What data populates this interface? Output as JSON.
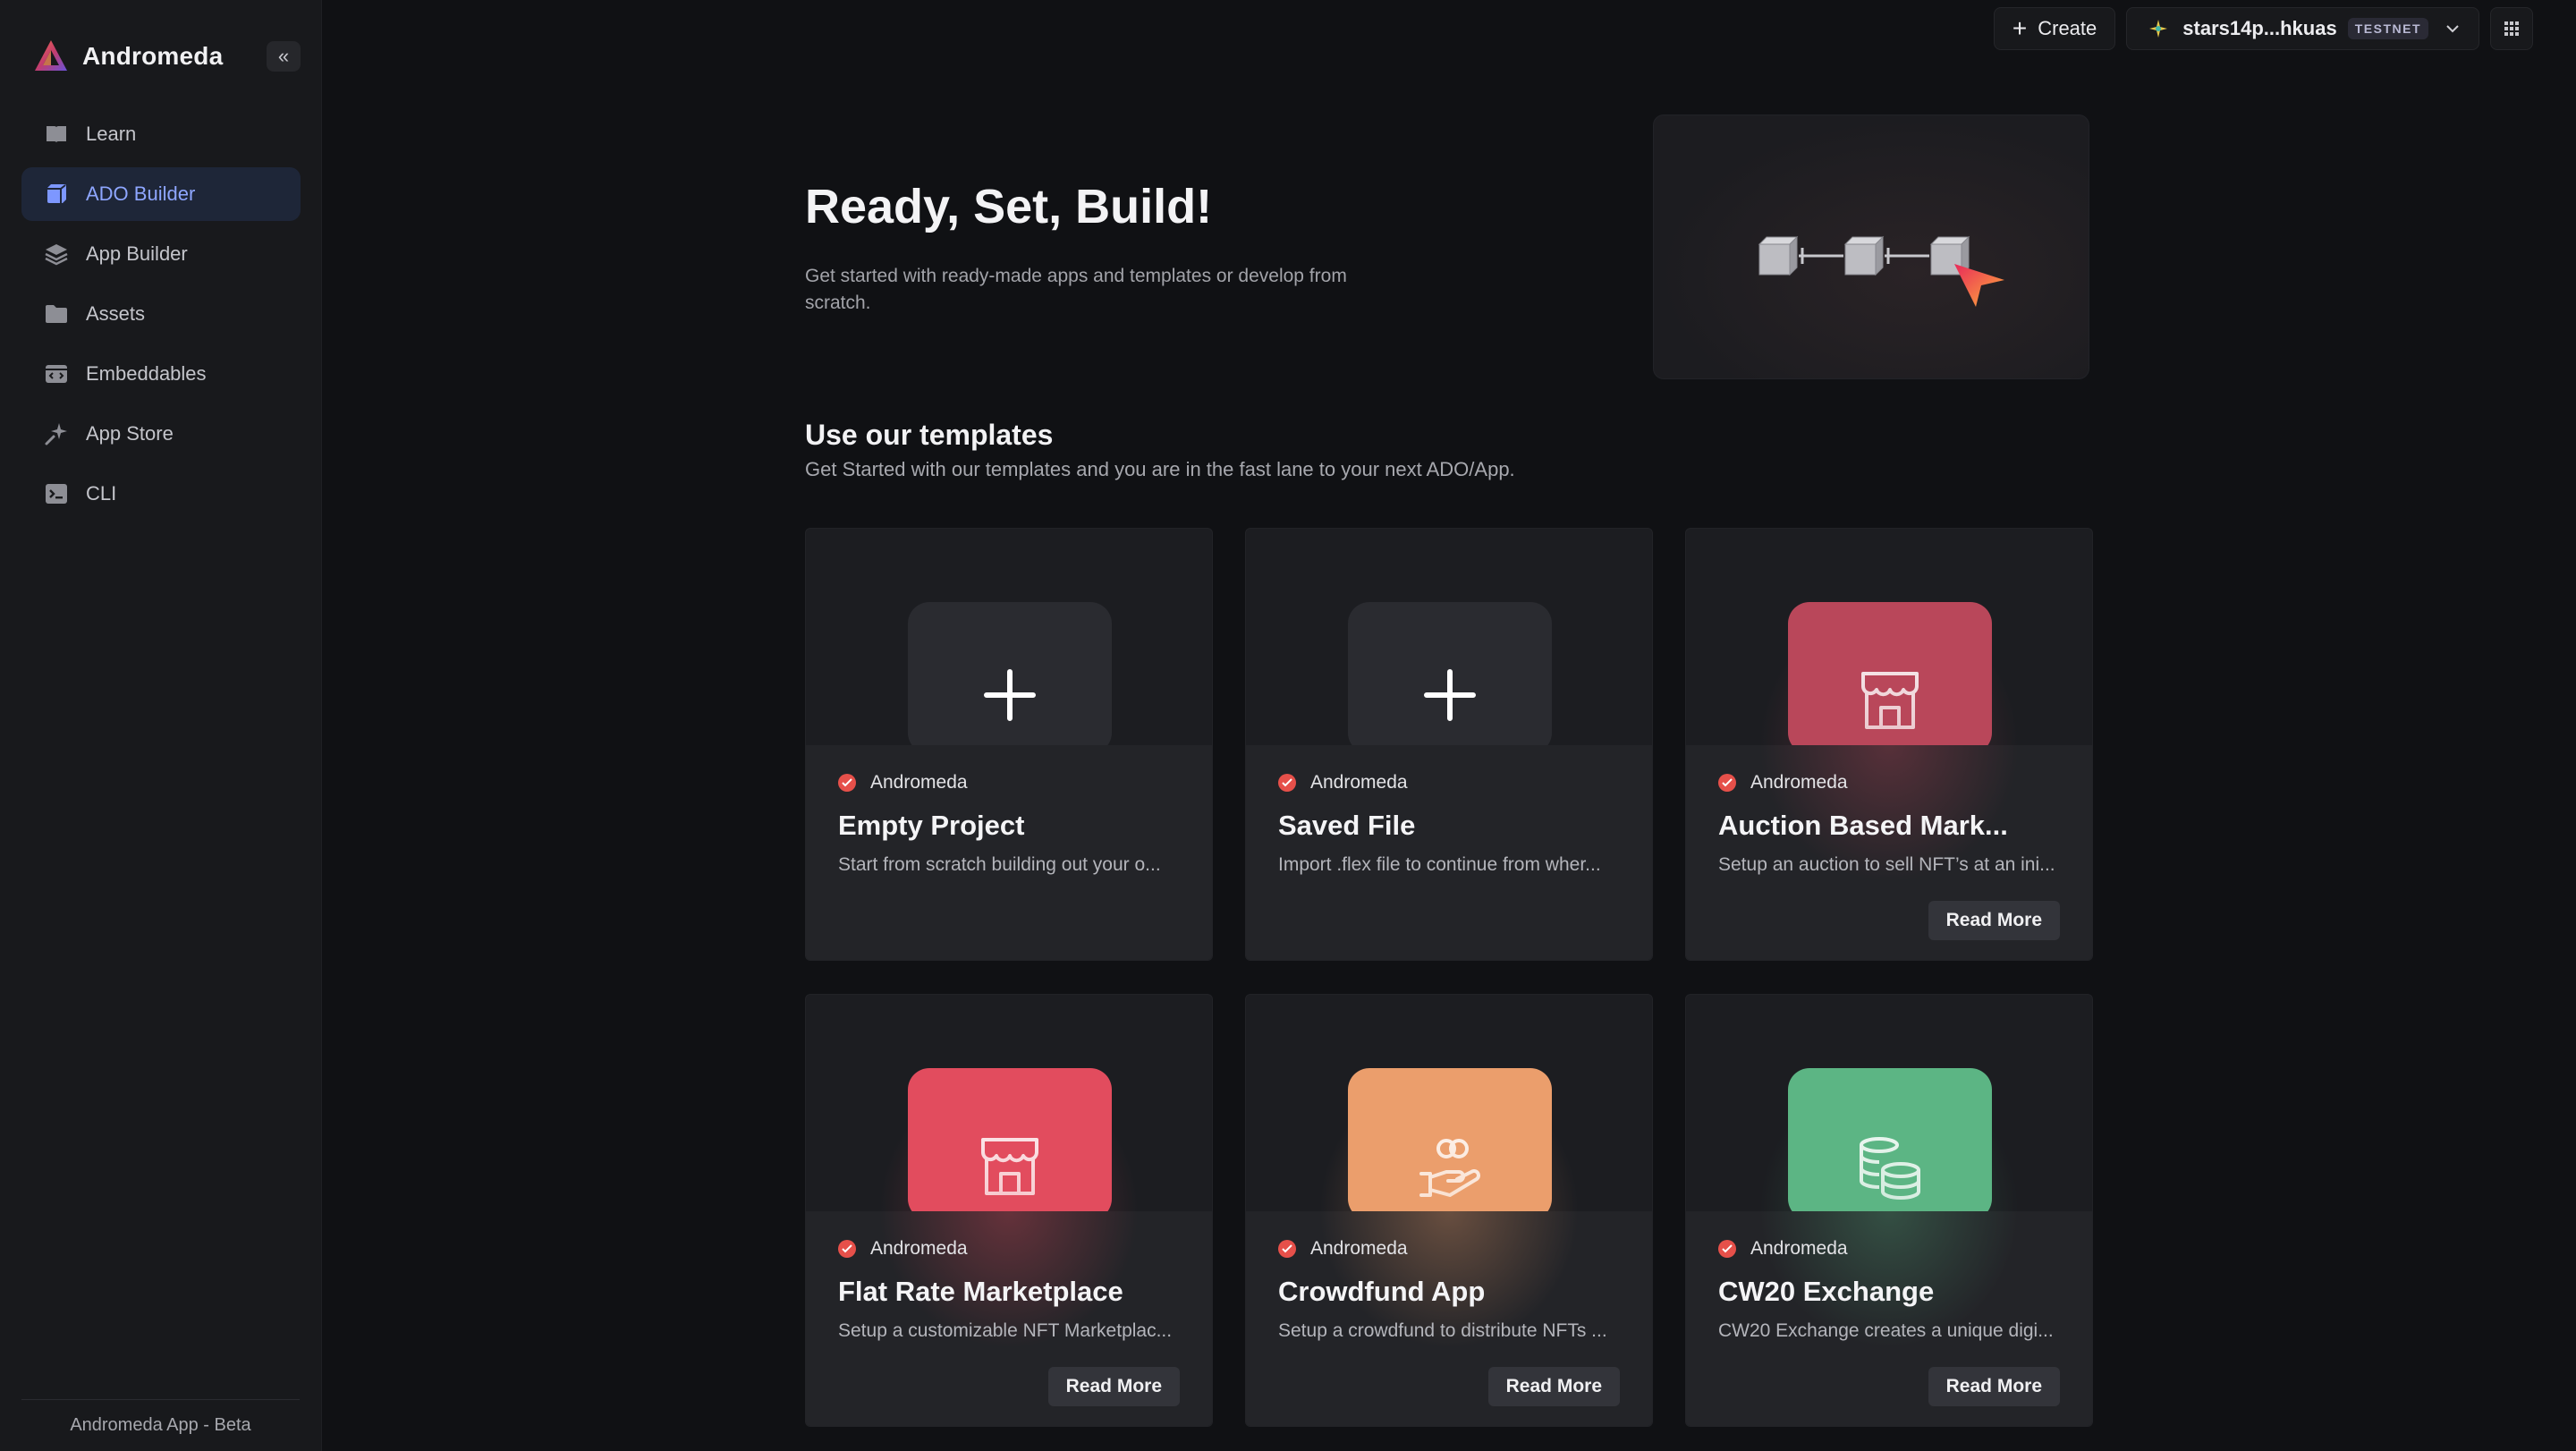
{
  "brand": {
    "name": "Andromeda"
  },
  "sidebar": {
    "items": [
      {
        "label": "Learn",
        "icon": "book-icon"
      },
      {
        "label": "ADO Builder",
        "icon": "cube-icon",
        "active": true
      },
      {
        "label": "App Builder",
        "icon": "layers-icon"
      },
      {
        "label": "Assets",
        "icon": "folder-icon"
      },
      {
        "label": "Embeddables",
        "icon": "embed-icon"
      },
      {
        "label": "App Store",
        "icon": "sparkle-icon"
      },
      {
        "label": "CLI",
        "icon": "terminal-icon"
      }
    ],
    "footer": "Andromeda App - Beta"
  },
  "topbar": {
    "create_label": "Create",
    "wallet_address": "stars14p...hkuas",
    "network_badge": "TESTNET"
  },
  "hero": {
    "title": "Ready, Set, Build!",
    "subtitle": "Get started with ready-made apps and templates or develop from scratch."
  },
  "templates": {
    "title": "Use our templates",
    "subtitle": "Get Started with our templates and you are in the fast lane to your next ADO/App.",
    "cards": [
      {
        "author": "Andromeda",
        "title": "Empty Project",
        "desc": "Start from scratch building out your o...",
        "icon": "plus-icon",
        "color": "#2a2b30",
        "read_more": ""
      },
      {
        "author": "Andromeda",
        "title": "Saved File",
        "desc": "Import .flex file to continue from wher...",
        "icon": "plus-icon",
        "color": "#2a2b30",
        "read_more": ""
      },
      {
        "author": "Andromeda",
        "title": "Auction Based Mark...",
        "desc": "Setup an auction to sell NFT’s at an ini...",
        "icon": "storefront-icon",
        "color": "#b9475a",
        "read_more": "Read More"
      },
      {
        "author": "Andromeda",
        "title": "Flat Rate Marketplace",
        "desc": "Setup a customizable NFT Marketplac...",
        "icon": "storefront-icon",
        "color": "#e24c5e",
        "read_more": "Read More"
      },
      {
        "author": "Andromeda",
        "title": "Crowdfund App",
        "desc": "Setup a crowdfund to distribute NFTs ...",
        "icon": "hand-coins-icon",
        "color": "#eb9e6c",
        "read_more": "Read More"
      },
      {
        "author": "Andromeda",
        "title": "CW20 Exchange",
        "desc": "CW20 Exchange creates a unique digi...",
        "icon": "coins-stack-icon",
        "color": "#5cb584",
        "read_more": "Read More"
      }
    ]
  },
  "colors": {
    "accent": "#8ea6ff",
    "background": "#101114",
    "sidebar": "#18191c"
  }
}
